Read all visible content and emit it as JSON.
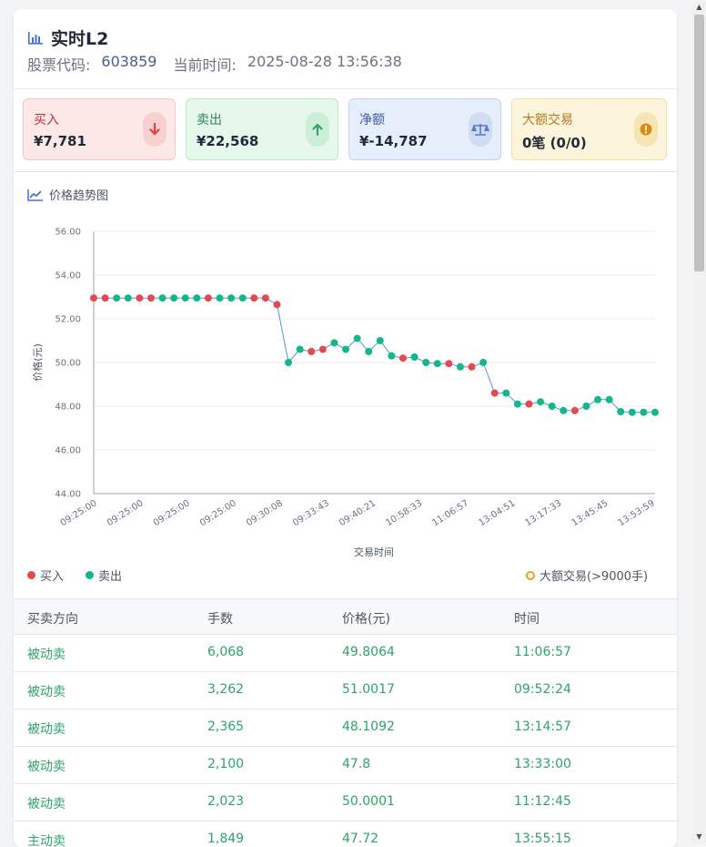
{
  "header": {
    "title": "实时L2",
    "stock_code_label": "股票代码:",
    "stock_code": "603859",
    "time_label": "当前时间:",
    "time_value": "2025-08-28 13:56:38"
  },
  "stats": {
    "buy": {
      "label": "买入",
      "value": "¥7,781",
      "icon": "arrow-down-icon",
      "color": "#e53e3e"
    },
    "sell": {
      "label": "卖出",
      "value": "¥22,568",
      "icon": "arrow-up-icon",
      "color": "#38a169"
    },
    "net": {
      "label": "净额",
      "value": "¥-14,787",
      "icon": "balance-scale-icon",
      "color": "#5a79c7"
    },
    "big": {
      "label": "大额交易",
      "value": "0笔 (0/0)",
      "icon": "warning-icon",
      "color": "#dd8a12"
    }
  },
  "chart_title": "价格趋势图",
  "chart_data": {
    "type": "scatter",
    "ylabel": "价格(元)",
    "xlabel": "交易时间",
    "ylim": [
      44,
      56
    ],
    "y_ticks": [
      "56.00",
      "54.00",
      "52.00",
      "50.00",
      "48.00",
      "46.00",
      "44.00"
    ],
    "x_tick_labels": [
      "09:25:00",
      "09:25:00",
      "09:25:00",
      "09:25:00",
      "09:30:08",
      "09:33:43",
      "09:40:21",
      "10:58:33",
      "11:06:57",
      "13:04:51",
      "13:17:33",
      "13:45:45",
      "13:53:59"
    ],
    "grid": true,
    "series_colors": {
      "buy": "#e5484d",
      "sell": "#12b886"
    },
    "points": [
      {
        "y": 52.95,
        "side": "buy"
      },
      {
        "y": 52.95,
        "side": "buy"
      },
      {
        "y": 52.95,
        "side": "sell"
      },
      {
        "y": 52.95,
        "side": "sell"
      },
      {
        "y": 52.95,
        "side": "buy"
      },
      {
        "y": 52.95,
        "side": "buy"
      },
      {
        "y": 52.95,
        "side": "sell"
      },
      {
        "y": 52.95,
        "side": "sell"
      },
      {
        "y": 52.95,
        "side": "sell"
      },
      {
        "y": 52.95,
        "side": "sell"
      },
      {
        "y": 52.95,
        "side": "buy"
      },
      {
        "y": 52.95,
        "side": "sell"
      },
      {
        "y": 52.95,
        "side": "sell"
      },
      {
        "y": 52.95,
        "side": "sell"
      },
      {
        "y": 52.95,
        "side": "buy"
      },
      {
        "y": 52.95,
        "side": "buy"
      },
      {
        "y": 52.65,
        "side": "buy"
      },
      {
        "y": 50.0,
        "side": "sell"
      },
      {
        "y": 50.6,
        "side": "sell"
      },
      {
        "y": 50.5,
        "side": "buy"
      },
      {
        "y": 50.6,
        "side": "buy"
      },
      {
        "y": 50.9,
        "side": "sell"
      },
      {
        "y": 50.6,
        "side": "sell"
      },
      {
        "y": 51.1,
        "side": "sell"
      },
      {
        "y": 50.5,
        "side": "sell"
      },
      {
        "y": 51.0,
        "side": "sell"
      },
      {
        "y": 50.3,
        "side": "sell"
      },
      {
        "y": 50.2,
        "side": "buy"
      },
      {
        "y": 50.25,
        "side": "sell"
      },
      {
        "y": 50.0,
        "side": "sell"
      },
      {
        "y": 49.95,
        "side": "sell"
      },
      {
        "y": 49.95,
        "side": "buy"
      },
      {
        "y": 49.8,
        "side": "sell"
      },
      {
        "y": 49.8,
        "side": "buy"
      },
      {
        "y": 50.0,
        "side": "sell"
      },
      {
        "y": 48.6,
        "side": "buy"
      },
      {
        "y": 48.6,
        "side": "sell"
      },
      {
        "y": 48.1,
        "side": "sell"
      },
      {
        "y": 48.1,
        "side": "buy"
      },
      {
        "y": 48.2,
        "side": "sell"
      },
      {
        "y": 48.0,
        "side": "sell"
      },
      {
        "y": 47.8,
        "side": "sell"
      },
      {
        "y": 47.8,
        "side": "buy"
      },
      {
        "y": 48.0,
        "side": "sell"
      },
      {
        "y": 48.3,
        "side": "sell"
      },
      {
        "y": 48.3,
        "side": "sell"
      },
      {
        "y": 47.75,
        "side": "sell"
      },
      {
        "y": 47.72,
        "side": "sell"
      },
      {
        "y": 47.72,
        "side": "sell"
      },
      {
        "y": 47.72,
        "side": "sell"
      }
    ]
  },
  "legend": {
    "buy": "买入",
    "sell": "卖出",
    "big": "大额交易(>9000手)"
  },
  "table": {
    "headers": [
      "买卖方向",
      "手数",
      "价格(元)",
      "时间"
    ],
    "rows": [
      [
        "被动卖",
        "6,068",
        "49.8064",
        "11:06:57"
      ],
      [
        "被动卖",
        "3,262",
        "51.0017",
        "09:52:24"
      ],
      [
        "被动卖",
        "2,365",
        "48.1092",
        "13:14:57"
      ],
      [
        "被动卖",
        "2,100",
        "47.8",
        "13:33:00"
      ],
      [
        "被动卖",
        "2,023",
        "50.0001",
        "11:12:45"
      ],
      [
        "主动卖",
        "1,849",
        "47.72",
        "13:55:15"
      ]
    ]
  }
}
